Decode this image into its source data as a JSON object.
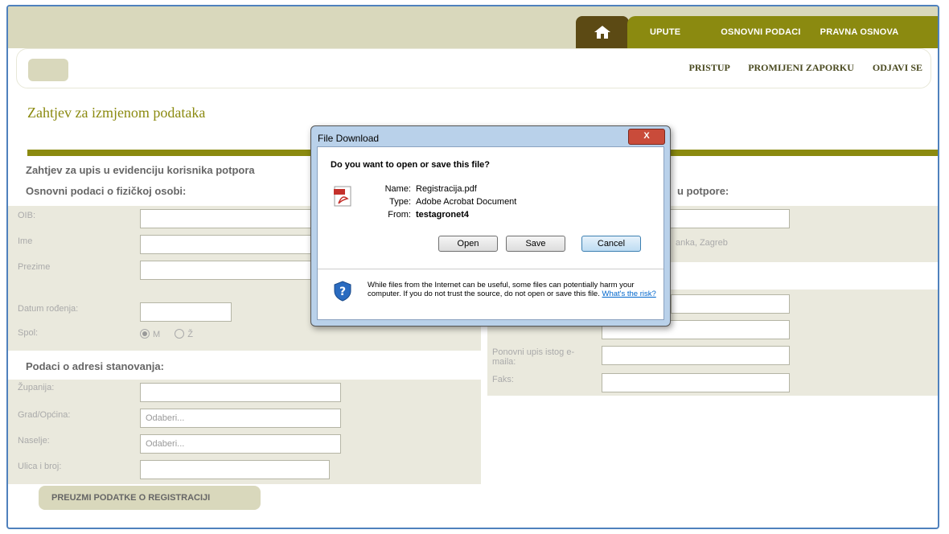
{
  "nav": {
    "tabs": [
      "UPUTE",
      "OSNOVNI PODACI",
      "PRAVNA OSNOVA"
    ],
    "sub_links": [
      "PRISTUP",
      "PROMIJENI ZAPORKU",
      "ODJAVI SE"
    ]
  },
  "page": {
    "title": "Zahtjev za izmjenom podataka",
    "form_heading": "Zahtjev za upis u evidenciju korisnika potpora",
    "section_person": "Osnovni podaci o fizičkoj osobi:",
    "section_right": "u potpore:",
    "section_address": "Podaci o adresi stanovanja:",
    "labels": {
      "oib": "OIB:",
      "ime": "Ime",
      "prezime": "Prezime",
      "datum": "Datum rođenja:",
      "spol": "Spol:",
      "zupanija": "Županija:",
      "grad": "Grad/Općina:",
      "naselje": "Naselje:",
      "ulica": "Ulica i broj:",
      "ponovni": "Ponovni upis istog e-maila:",
      "faks": "Faks:"
    },
    "gender": {
      "m": "M",
      "z": "Ž"
    },
    "placeholders": {
      "grad": "Odaberi...",
      "naselje": "Odaberi..."
    },
    "right_hint": "anka, Zagreb",
    "download_button": "PREUZMI PODATKE O REGISTRACIJI"
  },
  "dialog": {
    "title": "File Download",
    "close": "X",
    "question": "Do you want to open or save this file?",
    "name_key": "Name:",
    "name_val": "Registracija.pdf",
    "type_key": "Type:",
    "type_val": "Adobe Acrobat Document",
    "from_key": "From:",
    "from_val": "testagronet4",
    "btn_open": "Open",
    "btn_save": "Save",
    "btn_cancel": "Cancel",
    "warning": "While files from the Internet can be useful, some files can potentially harm your computer. If you do not trust the source, do not open or save this file.",
    "risk_link": "What's the risk?"
  },
  "colors": {
    "olive": "#8b8a10",
    "brown": "#5c4a14",
    "beige": "#d9d8bc"
  }
}
